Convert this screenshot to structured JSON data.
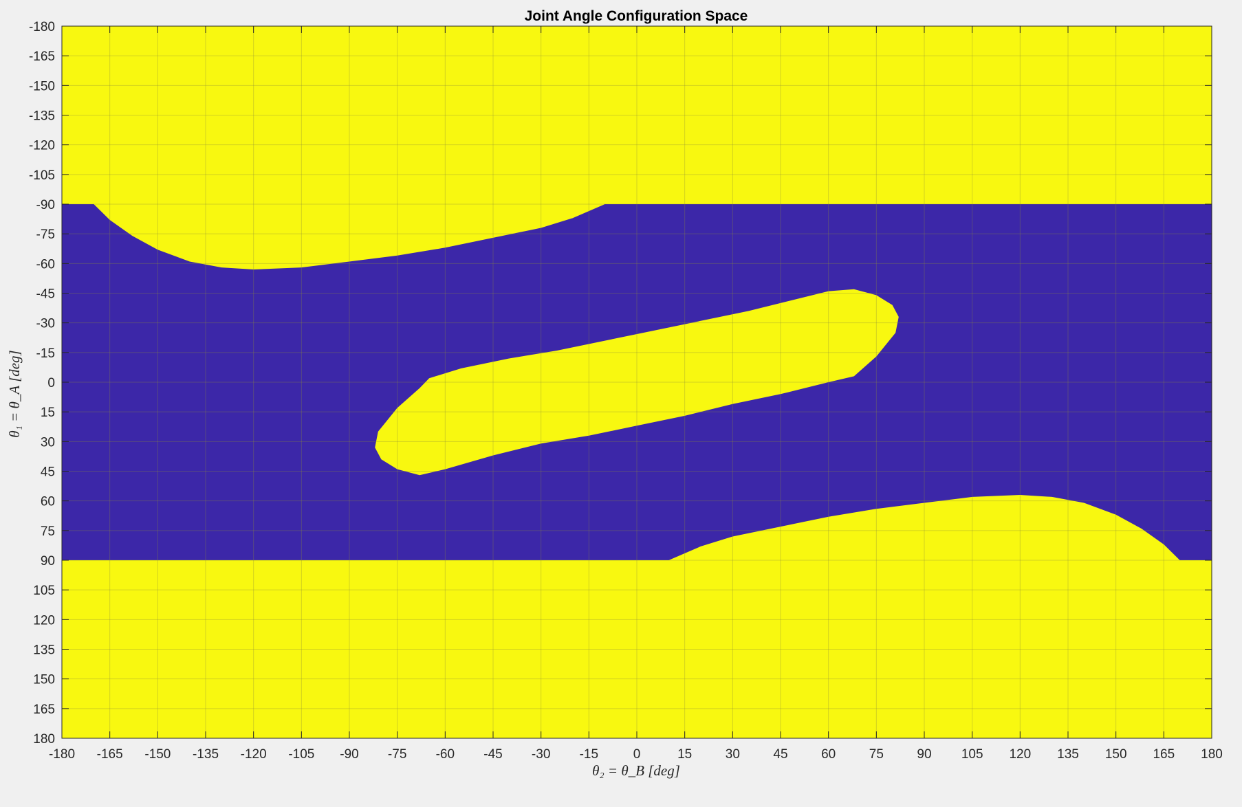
{
  "chart_data": {
    "type": "heatmap",
    "title": "Joint Angle Configuration Space",
    "xlabel": "θ₂ = θ_B [deg]",
    "ylabel": "θ₁ = θ_A [deg]",
    "xlim": [
      -180,
      180
    ],
    "ylim": [
      -180,
      180
    ],
    "y_direction": "reverse",
    "x_ticks": [
      -180,
      -165,
      -150,
      -135,
      -120,
      -105,
      -90,
      -75,
      -60,
      -45,
      -30,
      -15,
      0,
      15,
      30,
      45,
      60,
      75,
      90,
      105,
      120,
      135,
      150,
      165,
      180
    ],
    "y_ticks": [
      -180,
      -165,
      -150,
      -135,
      -120,
      -105,
      -90,
      -75,
      -60,
      -45,
      -30,
      -15,
      0,
      15,
      30,
      45,
      60,
      75,
      90,
      105,
      120,
      135,
      150,
      165,
      180
    ],
    "grid": true,
    "colors": {
      "reachable": "#3c27a8",
      "unreachable": "#f8f810",
      "background": "#f0f0f0",
      "grid": "#8c8c3c",
      "axis": "#262626"
    },
    "regions": [
      {
        "value": "unreachable",
        "kind": "rectangle",
        "x": [
          -180,
          180
        ],
        "y": [
          -180,
          -90
        ]
      },
      {
        "value": "reachable",
        "kind": "rectangle",
        "x": [
          -180,
          180
        ],
        "y": [
          -90,
          90
        ]
      },
      {
        "value": "unreachable",
        "kind": "rectangle",
        "x": [
          -180,
          180
        ],
        "y": [
          90,
          180
        ]
      },
      {
        "value": "unreachable",
        "kind": "boundary",
        "points": [
          [
            -170,
            -90
          ],
          [
            -165,
            -82
          ],
          [
            -158,
            -74
          ],
          [
            -150,
            -67
          ],
          [
            -140,
            -61
          ],
          [
            -130,
            -58
          ],
          [
            -120,
            -57
          ],
          [
            -105,
            -58
          ],
          [
            -90,
            -61
          ],
          [
            -75,
            -64
          ],
          [
            -60,
            -68
          ],
          [
            -45,
            -73
          ],
          [
            -30,
            -78
          ],
          [
            -20,
            -83
          ],
          [
            -10,
            -90
          ]
        ]
      },
      {
        "value": "unreachable",
        "kind": "boundary",
        "points": [
          [
            10,
            90
          ],
          [
            20,
            83
          ],
          [
            30,
            78
          ],
          [
            45,
            73
          ],
          [
            60,
            68
          ],
          [
            75,
            64
          ],
          [
            90,
            61
          ],
          [
            105,
            58
          ],
          [
            120,
            57
          ],
          [
            130,
            58
          ],
          [
            140,
            61
          ],
          [
            150,
            67
          ],
          [
            158,
            74
          ],
          [
            165,
            82
          ],
          [
            170,
            90
          ]
        ]
      },
      {
        "value": "unreachable",
        "kind": "boundary",
        "points": [
          [
            -65,
            -2
          ],
          [
            -55,
            -7
          ],
          [
            -40,
            -12
          ],
          [
            -25,
            -16
          ],
          [
            -10,
            -21
          ],
          [
            5,
            -26
          ],
          [
            20,
            -31
          ],
          [
            35,
            -36
          ],
          [
            50,
            -42
          ],
          [
            60,
            -46
          ],
          [
            68,
            -47
          ],
          [
            75,
            -44
          ],
          [
            80,
            -39
          ],
          [
            82,
            -33
          ],
          [
            81,
            -25
          ],
          [
            75,
            -13
          ],
          [
            68,
            -3
          ],
          [
            60,
            0
          ],
          [
            45,
            6
          ],
          [
            30,
            11
          ],
          [
            15,
            17
          ],
          [
            0,
            22
          ],
          [
            -15,
            27
          ],
          [
            -30,
            31
          ],
          [
            -45,
            37
          ],
          [
            -60,
            44
          ],
          [
            -68,
            47
          ],
          [
            -75,
            44
          ],
          [
            -80,
            39
          ],
          [
            -82,
            33
          ],
          [
            -81,
            25
          ],
          [
            -75,
            13
          ],
          [
            -68,
            3
          ]
        ]
      }
    ]
  }
}
